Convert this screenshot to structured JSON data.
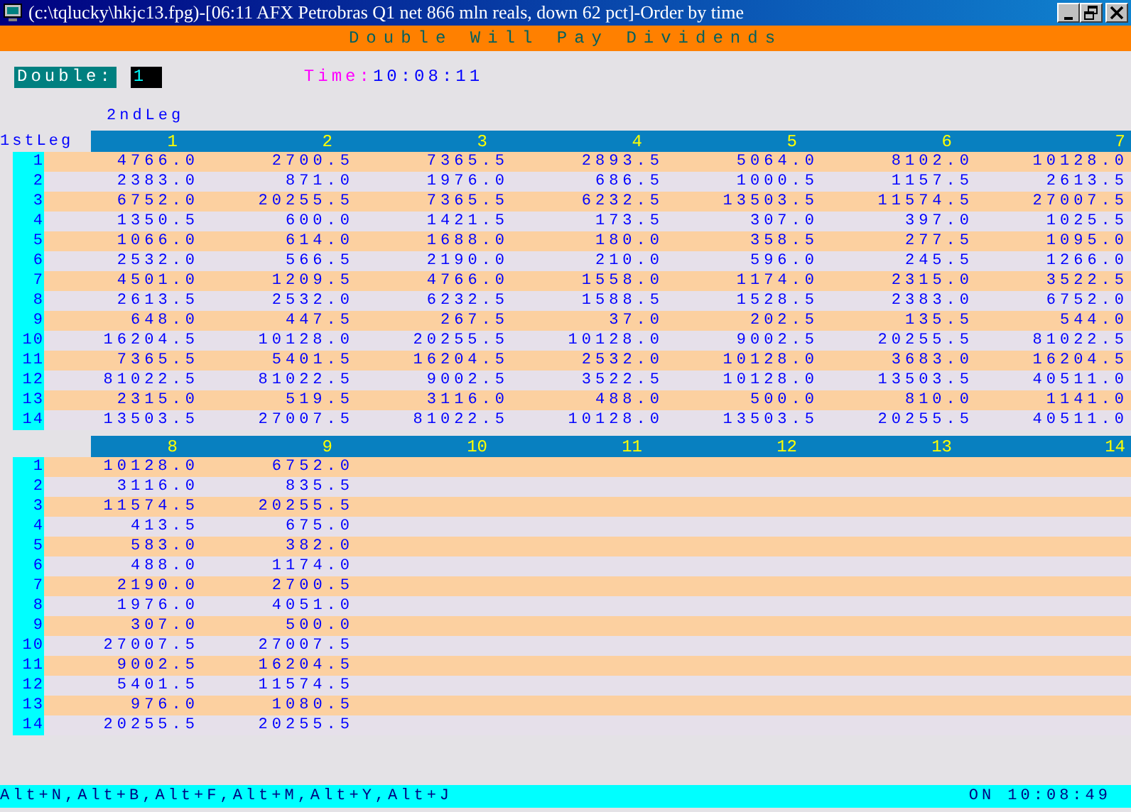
{
  "window": {
    "title": "(c:\\tqlucky\\hkjc13.fpg)-[06:11 AFX  Petrobras Q1 net 866 mln reals, down 62 pct]-Order by time"
  },
  "banner": "Double Will Pay Dividends",
  "double": {
    "label": "Double:",
    "value": "1"
  },
  "time": {
    "label": "Time:",
    "value": "10:08:11"
  },
  "col_axis_label": "2ndLeg",
  "row_axis_label": "1stLeg",
  "blocks": [
    {
      "columns": [
        "1",
        "2",
        "3",
        "4",
        "5",
        "6",
        "7"
      ],
      "rows": [
        {
          "label": "1",
          "values": [
            "4766.0",
            "2700.5",
            "7365.5",
            "2893.5",
            "5064.0",
            "8102.0",
            "10128.0"
          ]
        },
        {
          "label": "2",
          "values": [
            "2383.0",
            "871.0",
            "1976.0",
            "686.5",
            "1000.5",
            "1157.5",
            "2613.5"
          ]
        },
        {
          "label": "3",
          "values": [
            "6752.0",
            "20255.5",
            "7365.5",
            "6232.5",
            "13503.5",
            "11574.5",
            "27007.5"
          ]
        },
        {
          "label": "4",
          "values": [
            "1350.5",
            "600.0",
            "1421.5",
            "173.5",
            "307.0",
            "397.0",
            "1025.5"
          ]
        },
        {
          "label": "5",
          "values": [
            "1066.0",
            "614.0",
            "1688.0",
            "180.0",
            "358.5",
            "277.5",
            "1095.0"
          ]
        },
        {
          "label": "6",
          "values": [
            "2532.0",
            "566.5",
            "2190.0",
            "210.0",
            "596.0",
            "245.5",
            "1266.0"
          ]
        },
        {
          "label": "7",
          "values": [
            "4501.0",
            "1209.5",
            "4766.0",
            "1558.0",
            "1174.0",
            "2315.0",
            "3522.5"
          ]
        },
        {
          "label": "8",
          "values": [
            "2613.5",
            "2532.0",
            "6232.5",
            "1588.5",
            "1528.5",
            "2383.0",
            "6752.0"
          ]
        },
        {
          "label": "9",
          "values": [
            "648.0",
            "447.5",
            "267.5",
            "37.0",
            "202.5",
            "135.5",
            "544.0"
          ]
        },
        {
          "label": "10",
          "values": [
            "16204.5",
            "10128.0",
            "20255.5",
            "10128.0",
            "9002.5",
            "20255.5",
            "81022.5"
          ]
        },
        {
          "label": "11",
          "values": [
            "7365.5",
            "5401.5",
            "16204.5",
            "2532.0",
            "10128.0",
            "3683.0",
            "16204.5"
          ]
        },
        {
          "label": "12",
          "values": [
            "81022.5",
            "81022.5",
            "9002.5",
            "3522.5",
            "10128.0",
            "13503.5",
            "40511.0"
          ]
        },
        {
          "label": "13",
          "values": [
            "2315.0",
            "519.5",
            "3116.0",
            "488.0",
            "500.0",
            "810.0",
            "1141.0"
          ]
        },
        {
          "label": "14",
          "values": [
            "13503.5",
            "27007.5",
            "81022.5",
            "10128.0",
            "13503.5",
            "20255.5",
            "40511.0"
          ]
        }
      ]
    },
    {
      "columns": [
        "8",
        "9",
        "10",
        "11",
        "12",
        "13",
        "14"
      ],
      "rows": [
        {
          "label": "1",
          "values": [
            "10128.0",
            "6752.0"
          ]
        },
        {
          "label": "2",
          "values": [
            "3116.0",
            "835.5"
          ]
        },
        {
          "label": "3",
          "values": [
            "11574.5",
            "20255.5"
          ]
        },
        {
          "label": "4",
          "values": [
            "413.5",
            "675.0"
          ]
        },
        {
          "label": "5",
          "values": [
            "583.0",
            "382.0"
          ]
        },
        {
          "label": "6",
          "values": [
            "488.0",
            "1174.0"
          ]
        },
        {
          "label": "7",
          "values": [
            "2190.0",
            "2700.5"
          ]
        },
        {
          "label": "8",
          "values": [
            "1976.0",
            "4051.0"
          ]
        },
        {
          "label": "9",
          "values": [
            "307.0",
            "500.0"
          ]
        },
        {
          "label": "10",
          "values": [
            "27007.5",
            "27007.5"
          ]
        },
        {
          "label": "11",
          "values": [
            "9002.5",
            "16204.5"
          ]
        },
        {
          "label": "12",
          "values": [
            "5401.5",
            "11574.5"
          ]
        },
        {
          "label": "13",
          "values": [
            "976.0",
            "1080.5"
          ]
        },
        {
          "label": "14",
          "values": [
            "20255.5",
            "20255.5"
          ]
        }
      ]
    }
  ],
  "status_bar": {
    "shortcuts": "Alt+N,Alt+B,Alt+F,Alt+M,Alt+Y,Alt+J",
    "status": "ON 10:08:49"
  }
}
